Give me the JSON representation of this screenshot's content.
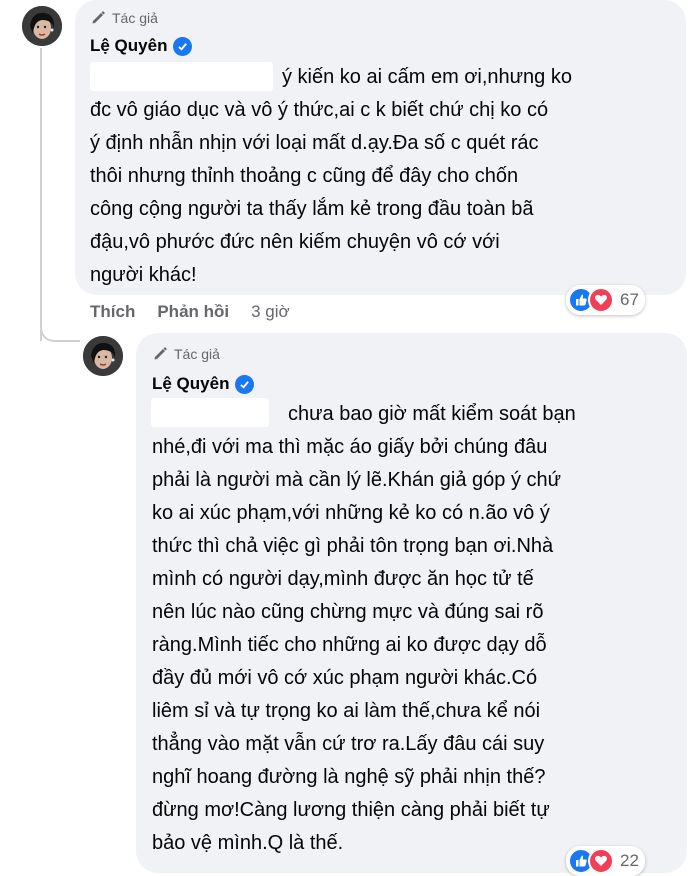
{
  "comments": [
    {
      "author_tag": "Tác giả",
      "author_name": "Lệ Quyên",
      "text": "ý kiến ko ai cấm em ơi,nhưng ko\nđc vô giáo dục và vô ý thức,ai c k biết chứ chị ko có\ný định nhẫn nhịn với loại mất d.ạy.Đa số c quét rác\nthôi nhưng thỉnh thoảng c cũng để đây cho chốn\ncông cộng người ta thấy lắm kẻ trong đầu toàn bã\nđậu,vô phước đức nên kiếm chuyện vô cớ với\nngười khác!",
      "actions": {
        "like": "Thích",
        "reply": "Phản hồi",
        "time": "3 giờ"
      },
      "reaction_count": "67"
    },
    {
      "author_tag": "Tác giả",
      "author_name": "Lệ Quyên",
      "text": "chưa bao giờ mất kiểm soát bạn\nnhé,đi với ma thì mặc áo giấy bởi chúng đâu\nphải là người mà cần lý lẽ.Khán giả góp ý chứ\nko ai xúc phạm,với những kẻ ko có n.ão vô ý\nthức thì chả việc gì phải tôn trọng bạn ơi.Nhà\nmình có người dạy,mình được ăn học tử tế\nnên lúc nào cũng chừng mực và đúng sai rõ\nràng.Mình tiếc cho những ai ko được dạy dỗ\nđầy đủ mới vô cớ xúc phạm người khác.Có\nliêm sỉ và tự trọng ko ai làm thế,chưa kể nói\nthẳng vào mặt vẫn cứ trơ ra.Lấy đâu cái suy\nnghĩ hoang đường là nghệ sỹ phải nhịn thế?\nđừng mơ!Càng lương thiện càng phải biết tự\nbảo vệ mình.Q là thế.",
      "reaction_count": "22"
    }
  ],
  "icons": {
    "author_tag": "pencil-icon",
    "verified": "verified-badge-icon",
    "like": "like-reaction-icon",
    "love": "love-reaction-icon"
  },
  "colors": {
    "bubble": "#f0f2f5",
    "verified": "#1877f2",
    "like": "#1877f2",
    "love": "#f33e58",
    "muted_text": "#65676b"
  }
}
